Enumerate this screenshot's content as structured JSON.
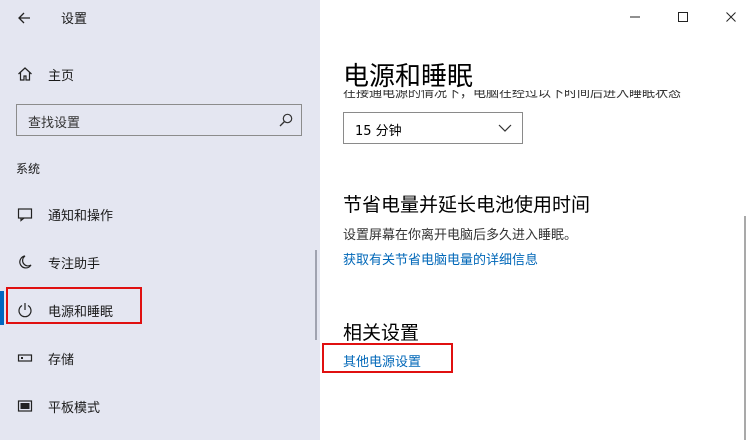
{
  "app": {
    "title": "设置"
  },
  "sidebar": {
    "home_label": "主页",
    "search_placeholder": "查找设置",
    "section_label": "系统",
    "items": [
      {
        "label": "通知和操作",
        "icon": "notification-icon"
      },
      {
        "label": "专注助手",
        "icon": "moon-icon"
      },
      {
        "label": "电源和睡眠",
        "icon": "power-icon",
        "active": true
      },
      {
        "label": "存储",
        "icon": "storage-icon"
      },
      {
        "label": "平板模式",
        "icon": "tablet-icon"
      }
    ]
  },
  "main": {
    "title": "电源和睡眠",
    "clipped_text": "在接通电源的情况下，电脑在经过以下时间后进入睡眠状态",
    "sleep_dropdown_value": "15 分钟",
    "battery_heading": "节省电量并延长电池使用时间",
    "battery_text": "设置屏幕在你离开电脑后多久进入睡眠。",
    "battery_link": "获取有关节省电脑电量的详细信息",
    "related_heading": "相关设置",
    "related_link": "其他电源设置"
  },
  "colors": {
    "accent": "#0067c0",
    "highlight": "#e01010",
    "sidebar_bg": "#e4e6f1",
    "link": "#0067b8"
  }
}
